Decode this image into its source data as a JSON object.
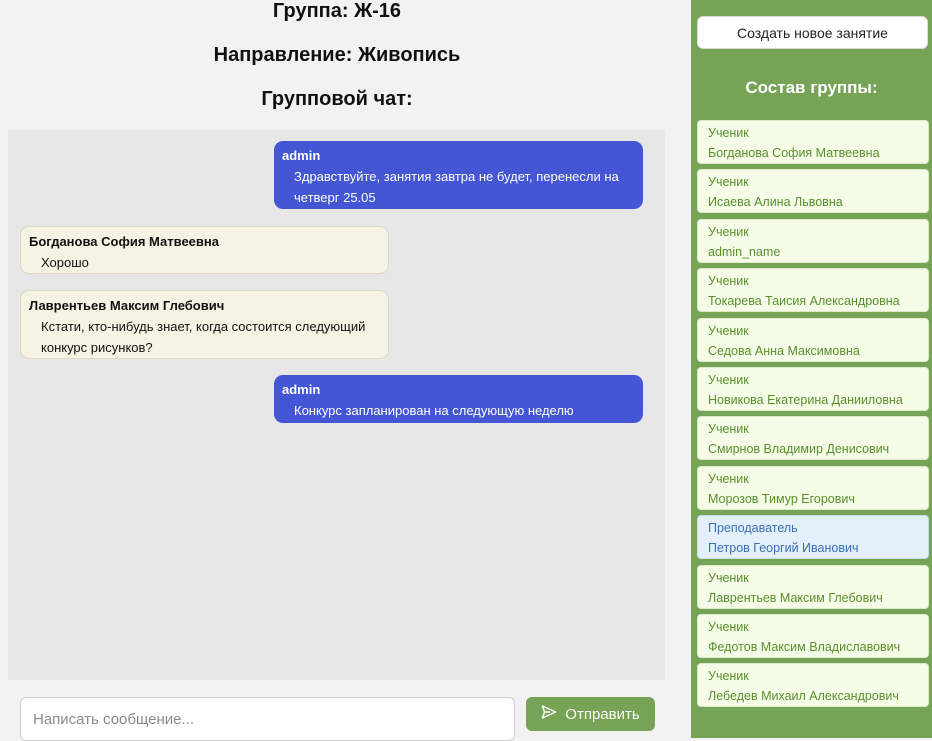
{
  "header": {
    "group": "Группа: Ж-16",
    "direction": "Направление: Живопись",
    "chat_title": "Групповой чат:"
  },
  "chat": {
    "messages": [
      {
        "author": "admin",
        "text": "Здравствуйте, занятия завтра не будет, перенесли на четверг 25.05",
        "role": "admin"
      },
      {
        "author": "Богданова София Матвеевна",
        "text": "Хорошо",
        "role": "other"
      },
      {
        "author": "Лаврентьев Максим Глебович",
        "text": "Кстати, кто-нибудь знает, когда состоится следующий конкурс рисунков?",
        "role": "other"
      },
      {
        "author": "admin",
        "text": "Конкурс запланирован на следующую неделю",
        "role": "admin"
      }
    ]
  },
  "composer": {
    "placeholder": "Написать сообщение...",
    "send_label": "Отправить",
    "send_icon": "send-icon"
  },
  "sidebar": {
    "create_label": "Создать новое занятие",
    "title": "Состав группы:",
    "members": [
      {
        "role": "Ученик",
        "name": "Богданова София Матвеевна"
      },
      {
        "role": "Ученик",
        "name": "Исаева Алина Львовна"
      },
      {
        "role": "Ученик",
        "name": "admin_name"
      },
      {
        "role": "Ученик",
        "name": "Токарева Таисия Александровна"
      },
      {
        "role": "Ученик",
        "name": "Седова Анна Максимовна"
      },
      {
        "role": "Ученик",
        "name": "Новикова Екатерина Данииловна"
      },
      {
        "role": "Ученик",
        "name": "Смирнов Владимир Денисович"
      },
      {
        "role": "Ученик",
        "name": "Морозов Тимур Егорович"
      },
      {
        "role": "Преподаватель",
        "name": "Петров Георгий Иванович"
      },
      {
        "role": "Ученик",
        "name": "Лаврентьев Максим Глебович"
      },
      {
        "role": "Ученик",
        "name": "Федотов Максим Владиславович"
      },
      {
        "role": "Ученик",
        "name": "Лебедев Михаил Александрович"
      }
    ]
  },
  "colors": {
    "accent_green": "#76a355",
    "admin_bubble": "#4456d4",
    "other_bubble": "#f6f3e4",
    "student_card": "#f5fde9",
    "teacher_card": "#e3f0fb"
  }
}
